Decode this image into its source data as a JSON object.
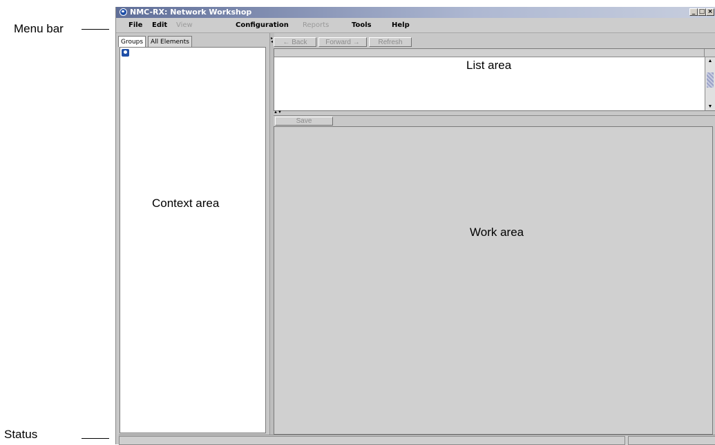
{
  "callouts": {
    "menu_bar": "Menu bar",
    "status": "Status"
  },
  "window": {
    "title": "NMC-RX: Network Workshop",
    "controls": [
      "_",
      "□",
      "×"
    ]
  },
  "menubar": {
    "items": [
      {
        "label": "File",
        "enabled": true
      },
      {
        "label": "Edit",
        "enabled": true
      },
      {
        "label": "View",
        "enabled": false
      },
      {
        "label": "Configuration",
        "enabled": true
      },
      {
        "label": "Reports",
        "enabled": false
      },
      {
        "label": "Tools",
        "enabled": true
      },
      {
        "label": "Help",
        "enabled": true
      }
    ]
  },
  "context": {
    "tabs": [
      "Groups",
      "All Elements"
    ],
    "active_tab": "Groups",
    "area_label": "Context area"
  },
  "nav": {
    "back": "← Back",
    "forward": "Forward →",
    "refresh": "Refresh"
  },
  "list": {
    "area_label": "List area"
  },
  "work": {
    "save": "Save",
    "area_label": "Work area"
  },
  "icons": {
    "app": "globe-icon",
    "tree_root": "network-root-icon"
  },
  "colors": {
    "titlebar_start": "#5f6e98",
    "panel_bg": "#c8c8c8",
    "disabled_text": "#8c8c8c"
  }
}
